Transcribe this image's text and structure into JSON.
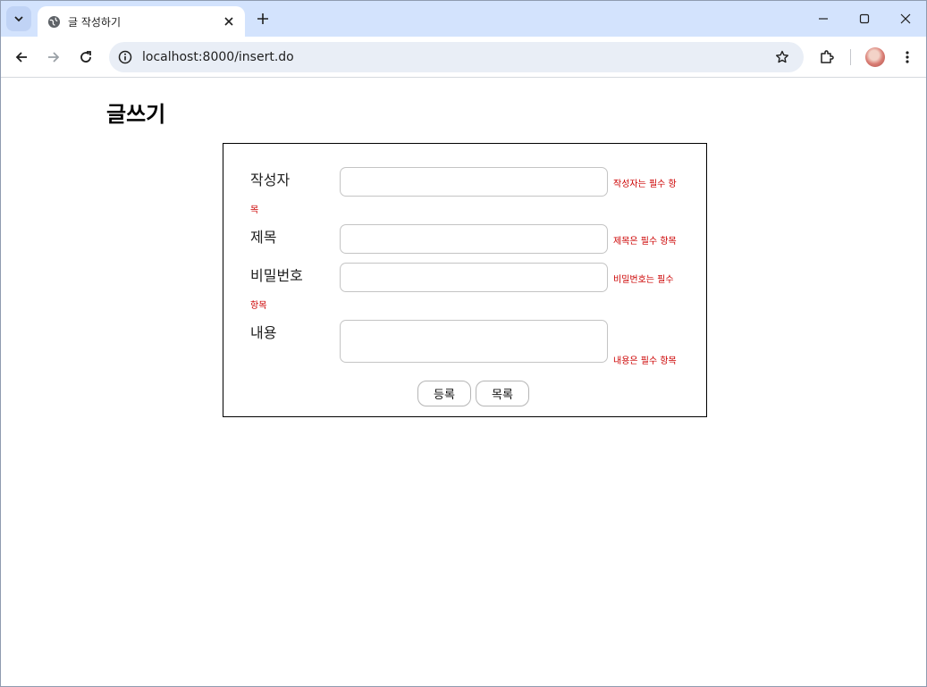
{
  "browser": {
    "tab_title": "글 작성하기",
    "url": "localhost:8000/insert.do"
  },
  "page": {
    "title": "글쓰기"
  },
  "form": {
    "writer": {
      "label": "작성자",
      "value": "",
      "error_part1": "작성자는 필수 항",
      "error_part2": "목"
    },
    "subject": {
      "label": "제목",
      "value": "",
      "error": "제목은 필수 항목"
    },
    "password": {
      "label": "비밀번호",
      "value": "",
      "error_part1": "비밀번호는 필수",
      "error_part2": "항목"
    },
    "content": {
      "label": "내용",
      "value": "",
      "error": "내용은 필수 항목"
    },
    "submit_label": "등록",
    "list_label": "목록"
  },
  "colors": {
    "tabstrip": "#d3e3fd",
    "error": "#cc0000"
  }
}
